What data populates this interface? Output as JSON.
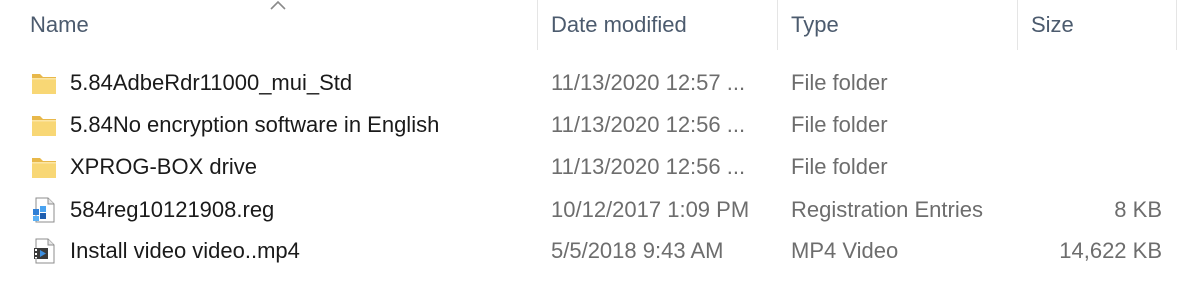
{
  "columns": {
    "name": "Name",
    "date_modified": "Date modified",
    "type": "Type",
    "size": "Size"
  },
  "sort": {
    "column": "name",
    "direction": "ascending",
    "icon": "chevron-up-icon"
  },
  "files": [
    {
      "name": "5.84AdbeRdr11000_mui_Std",
      "date_modified": "11/13/2020 12:57 ...",
      "type": "File folder",
      "size": "",
      "icon": "folder-icon"
    },
    {
      "name": "5.84No encryption software in English",
      "date_modified": "11/13/2020 12:56 ...",
      "type": "File folder",
      "size": "",
      "icon": "folder-icon"
    },
    {
      "name": "XPROG-BOX drive",
      "date_modified": "11/13/2020 12:56 ...",
      "type": "File folder",
      "size": "",
      "icon": "folder-icon"
    },
    {
      "name": "584reg10121908.reg",
      "date_modified": "10/12/2017 1:09 PM",
      "type": "Registration Entries",
      "size": "8 KB",
      "icon": "registry-file-icon"
    },
    {
      "name": "Install video video..mp4",
      "date_modified": "5/5/2018 9:43 AM",
      "type": "MP4 Video",
      "size": "14,622 KB",
      "icon": "video-file-icon"
    }
  ],
  "colors": {
    "header_text": "#4c5b6e",
    "primary_text": "#1a1a1a",
    "secondary_text": "#6d6d6d",
    "folder_yellow": "#f8d775"
  }
}
